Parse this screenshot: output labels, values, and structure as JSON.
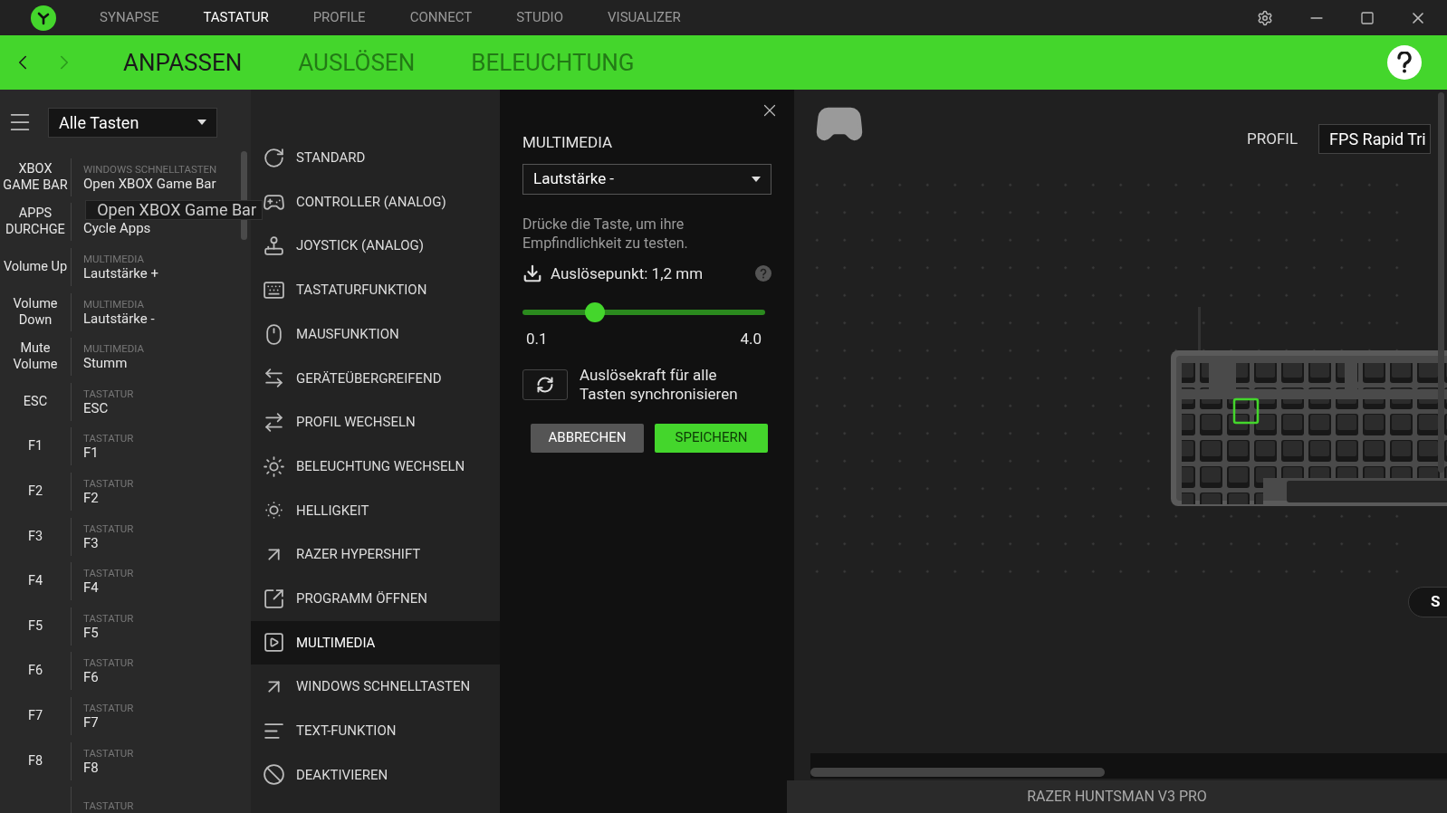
{
  "title_bar": {
    "tabs": [
      {
        "label": "SYNAPSE",
        "selected": false
      },
      {
        "label": "TASTATUR",
        "selected": true
      },
      {
        "label": "PROFILE",
        "selected": false
      },
      {
        "label": "CONNECT",
        "selected": false
      },
      {
        "label": "STUDIO",
        "selected": false
      },
      {
        "label": "VISUALIZER",
        "selected": false
      }
    ]
  },
  "sub_bar": {
    "back_disabled": false,
    "forward_disabled": true,
    "tabs": [
      {
        "label": "ANPASSEN",
        "selected": true
      },
      {
        "label": "AUSLÖSEN",
        "selected": false
      },
      {
        "label": "BELEUCHTUNG",
        "selected": false
      }
    ]
  },
  "key_list": {
    "filter": "Alle Tasten",
    "drag_label": "Open XBOX Game Bar",
    "rows": [
      {
        "key": "XBOX GAME BAR",
        "category": "WINDOWS SCHNELLTASTEN",
        "value": "Open XBOX Game Bar"
      },
      {
        "key": "APPS DURCHGE",
        "value": "Cycle Apps"
      },
      {
        "key": "Volume Up",
        "category": "MULTIMEDIA",
        "value": "Lautstärke +"
      },
      {
        "key": "Volume Down",
        "category": "MULTIMEDIA",
        "value": "Lautstärke -"
      },
      {
        "key": "Mute Volume",
        "category": "MULTIMEDIA",
        "value": "Stumm"
      },
      {
        "key": "ESC",
        "category": "TASTATUR",
        "value": "ESC"
      },
      {
        "key": "F1",
        "category": "TASTATUR",
        "value": "F1"
      },
      {
        "key": "F2",
        "category": "TASTATUR",
        "value": "F2"
      },
      {
        "key": "F3",
        "category": "TASTATUR",
        "value": "F3"
      },
      {
        "key": "F4",
        "category": "TASTATUR",
        "value": "F4"
      },
      {
        "key": "F5",
        "category": "TASTATUR",
        "value": "F5"
      },
      {
        "key": "F6",
        "category": "TASTATUR",
        "value": "F6"
      },
      {
        "key": "F7",
        "category": "TASTATUR",
        "value": "F7"
      },
      {
        "key": "F8",
        "category": "TASTATUR",
        "value": "F8"
      },
      {
        "category": "TASTATUR"
      }
    ]
  },
  "functions": [
    {
      "label": "STANDARD",
      "selected": false
    },
    {
      "label": "CONTROLLER (ANALOG)",
      "selected": false
    },
    {
      "label": "JOYSTICK (ANALOG)",
      "selected": false
    },
    {
      "label": "TASTATURFUNKTION",
      "selected": false
    },
    {
      "label": "MAUSFUNKTION",
      "selected": false
    },
    {
      "label": "GERÄTEÜBERGREIFEND",
      "selected": false
    },
    {
      "label": "PROFIL WECHSELN",
      "selected": false
    },
    {
      "label": "BELEUCHTUNG WECHSELN",
      "selected": false
    },
    {
      "label": "HELLIGKEIT",
      "selected": false
    },
    {
      "label": "RAZER HYPERSHIFT",
      "selected": false
    },
    {
      "label": "PROGRAMM ÖFFNEN",
      "selected": false
    },
    {
      "label": "MULTIMEDIA",
      "selected": true
    },
    {
      "label": "WINDOWS SCHNELLTASTEN",
      "selected": false
    },
    {
      "label": "TEXT-FUNKTION",
      "selected": false
    },
    {
      "label": "DEAKTIVIEREN",
      "selected": false
    }
  ],
  "editor": {
    "title": "MULTIMEDIA",
    "select": "Lautstärke -",
    "hint": "Drücke die Taste, um ihre Empfindlichkeit zu testen.",
    "actuation": {
      "label": "Auslösepunkt: 1,2 mm",
      "level": 0.3,
      "min": "0.1",
      "max": "4.0"
    },
    "sync_label": "Auslösekraft für alle Tasten synchronisieren",
    "buttons": [
      {
        "label": "ABBRECHEN",
        "kind": "secondary"
      },
      {
        "label": "SPEICHERN",
        "kind": "primary"
      }
    ]
  },
  "canvas": {
    "profile_label": "PROFIL",
    "profile": "FPS Rapid Tri",
    "side_button": "S",
    "device": "RAZER HUNTSMAN V3 PRO"
  }
}
